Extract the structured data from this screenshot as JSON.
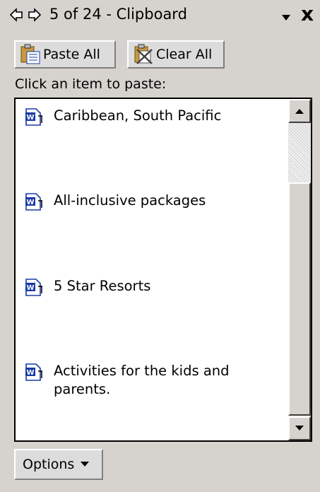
{
  "titlebar": {
    "title": "5 of 24 - Clipboard",
    "back_icon": "left-arrow-icon",
    "forward_icon": "right-arrow-icon",
    "menu_icon": "chevron-down-icon",
    "close_label": "x"
  },
  "toolbar": {
    "paste_all_label": "Paste All",
    "clear_all_label": "Clear All"
  },
  "hint": "Click an item to paste:",
  "clipboard_items": [
    {
      "icon": "word-document-icon",
      "text": "Caribbean, South Pacific"
    },
    {
      "icon": "word-document-icon",
      "text": "All-inclusive packages"
    },
    {
      "icon": "word-document-icon",
      "text": "5 Star Resorts"
    },
    {
      "icon": "word-document-icon",
      "text": "Activities for the kids and parents."
    }
  ],
  "footer": {
    "options_label": "Options"
  },
  "colors": {
    "panel_bg": "#d6d3ce",
    "list_bg": "#ffffff",
    "word_icon_blue": "#1a3aa8"
  }
}
